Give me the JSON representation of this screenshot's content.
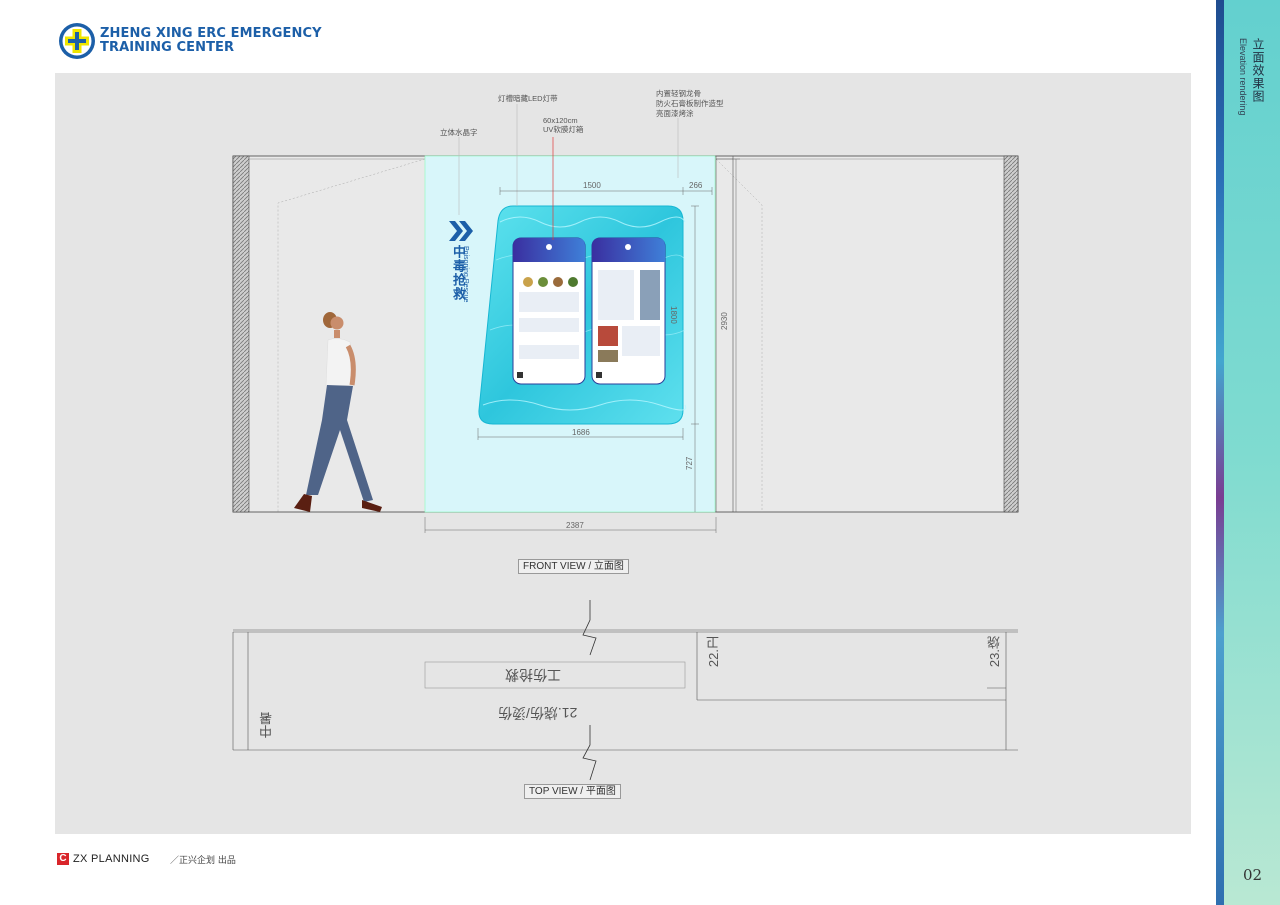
{
  "brand": {
    "line1": "ZHENG XING ERC EMERGENCY",
    "line2": "TRAINING CENTER"
  },
  "sidebar": {
    "title_cn": "立面效果图",
    "title_en": "Elevation rendering",
    "page_number": "02"
  },
  "annotations": {
    "crystal_text": "立体水晶字",
    "led_strip": "灯槽暗藏LED灯带",
    "lightbox_size": "60x120cm",
    "lightbox_name": "UV软膜灯箱",
    "keel_1": "内置轻钢龙骨",
    "keel_2": "防火石膏板制作造型",
    "keel_3": "亮面漆烤涂"
  },
  "dimensions": {
    "d1500": "1500",
    "d266": "266",
    "d1800": "1800",
    "d2930": "2930",
    "d1686": "1686",
    "d727": "727",
    "d2387": "2387"
  },
  "sign": {
    "cn": "中毒抢救",
    "en": "Poisoning Rescue"
  },
  "views": {
    "front": "FRONT VIEW / 立面图",
    "top": "TOP VIEW / 平面图"
  },
  "plan_labels": {
    "a": "22.卫",
    "b": "23.烧",
    "c": "工伤抢救",
    "d": "21.烧伤/烫伤",
    "e": "中暑"
  },
  "footer": {
    "logo_letter": "C",
    "brand": "ZX PLANNING",
    "cn": "／正兴企划 出品"
  },
  "colors": {
    "brand_blue": "#1c5fa8",
    "panel_cyan": "#d8f6fa",
    "glow": "#3fd6ea",
    "logo_red": "#d9252a"
  }
}
